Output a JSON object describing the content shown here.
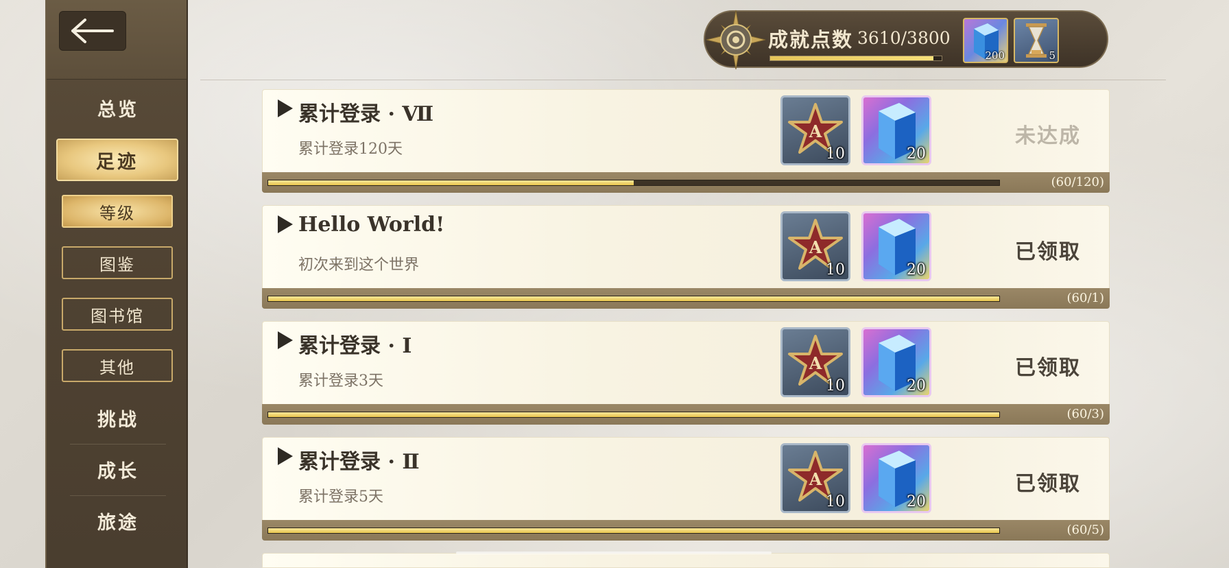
{
  "sidebar": {
    "back_label": "",
    "nav": {
      "overview": "总览",
      "footprints": "足迹",
      "challenge": "挑战",
      "growth": "成长",
      "journey": "旅途"
    },
    "sub": {
      "level": "等级",
      "codex": "图鉴",
      "library": "图书馆",
      "other": "其他"
    }
  },
  "header": {
    "points_label": "成就点数",
    "points_value": "3610/3800",
    "points_fraction": 0.95,
    "items": [
      {
        "icon": "blue-crystal-icon",
        "count": "200"
      },
      {
        "icon": "hourglass-icon",
        "count": "5"
      }
    ]
  },
  "achievements": [
    {
      "title": "累计登录 · Ⅶ",
      "desc": "累计登录120天",
      "rewards": [
        {
          "icon": "star-badge-icon",
          "qty": "10"
        },
        {
          "icon": "blue-crystal-icon",
          "qty": "20"
        }
      ],
      "status": "未达成",
      "progress_text": "(60/120)",
      "progress": 0.5
    },
    {
      "title": "Hello World!",
      "desc": "初次来到这个世界",
      "rewards": [
        {
          "icon": "star-badge-icon",
          "qty": "10"
        },
        {
          "icon": "blue-crystal-icon",
          "qty": "20"
        }
      ],
      "status": "已领取",
      "progress_text": "(60/1)",
      "progress": 1
    },
    {
      "title": "累计登录 · Ⅰ",
      "desc": "累计登录3天",
      "rewards": [
        {
          "icon": "star-badge-icon",
          "qty": "10"
        },
        {
          "icon": "blue-crystal-icon",
          "qty": "20"
        }
      ],
      "status": "已领取",
      "progress_text": "(60/3)",
      "progress": 1
    },
    {
      "title": "累计登录 · Ⅱ",
      "desc": "累计登录5天",
      "rewards": [
        {
          "icon": "star-badge-icon",
          "qty": "10"
        },
        {
          "icon": "blue-crystal-icon",
          "qty": "20"
        }
      ],
      "status": "已领取",
      "progress_text": "(60/5)",
      "progress": 1
    }
  ],
  "colors": {
    "sidebar_bg": "#4f4232",
    "active_gold": "#e8c77e",
    "progress_fill": "#e6c44c",
    "card_bg": "#f8f3e2"
  }
}
